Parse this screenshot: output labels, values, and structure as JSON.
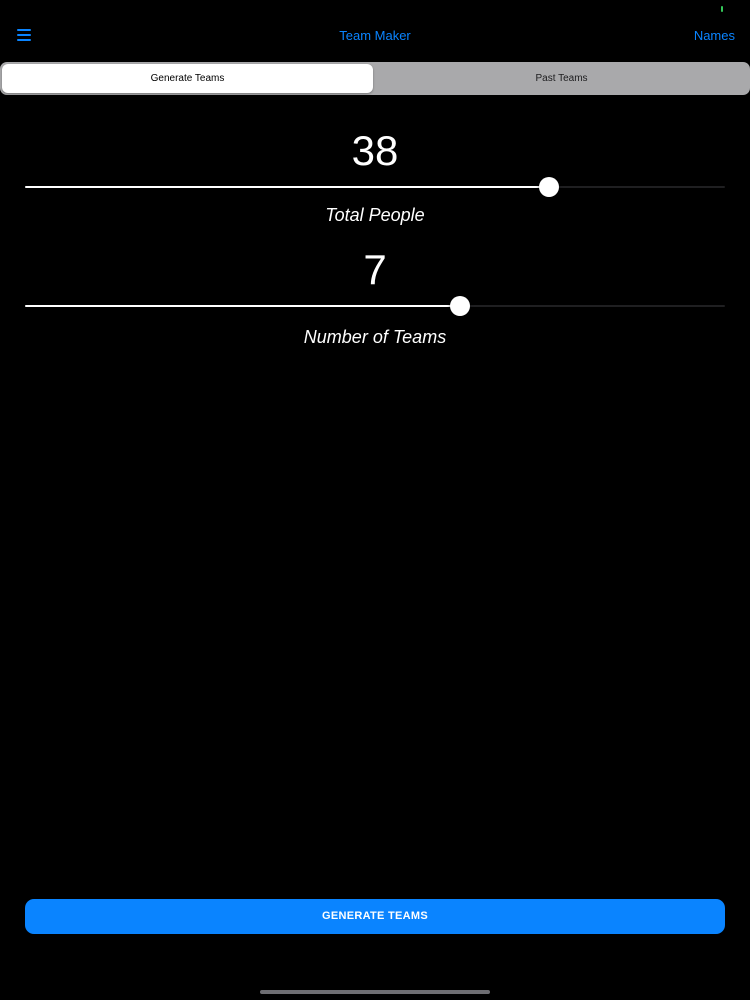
{
  "status": {
    "indicator_color": "#34c759"
  },
  "nav": {
    "menu_icon": "hamburger-menu-icon",
    "title": "Team Maker",
    "right_label": "Names",
    "tint_color": "#0a84ff"
  },
  "tabs": {
    "items": [
      {
        "label": "Generate Teams",
        "selected": true
      },
      {
        "label": "Past Teams",
        "selected": false
      }
    ]
  },
  "sliders": {
    "total_people": {
      "value": "38",
      "label": "Total People",
      "fill_fraction": 0.748
    },
    "number_of_teams": {
      "value": "7",
      "label": "Number of Teams",
      "fill_fraction": 0.621
    }
  },
  "actions": {
    "generate_label": "GENERATE TEAMS",
    "button_color": "#0a84ff"
  }
}
